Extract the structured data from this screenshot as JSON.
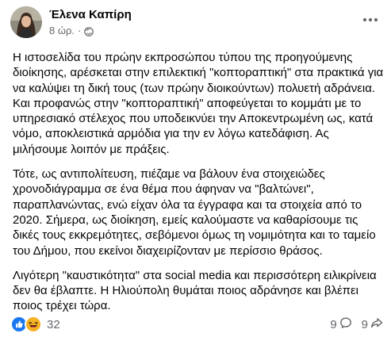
{
  "post": {
    "author": "Έλενα Καπίρη",
    "time": "8 ώρ.",
    "separator": "·",
    "visibility_icon": "globe-icon",
    "more_icon": "more-horizontal-icon",
    "paragraphs": [
      "Η ιστοσελίδα του πρώην εκπροσώπου τύπου της προηγούμενης διοίκησης, αρέσκεται στην επιλεκτική \"κοπτοραπτική\" στα πρακτικά για να καλύψει τη δική τους (των πρώην διοικούντων) πολυετή αδράνεια. Και προφανώς στην \"κοπτοραπτική\" αποφεύγεται το κομμάτι με το υπηρεσιακό στέλεχος που υποδεικνύει την Αποκεντρωμένη ως, κατά νόμο, αποκλειστικά αρμόδια για την εν λόγω κατεδάφιση. Ας  μιλήσουμε λοιπόν με πράξεις.",
      "Τότε, ως αντιπολίτευση,  πιέζαμε να βάλουν ένα στοιχειώδες χρονοδιάγραμμα σε ένα θέμα που άφηναν να \"βαλτώνει\", παραπλανώντας, ενώ είχαν όλα τα έγγραφα και τα στοιχεία από το 2020. Σήμερα, ως διοίκηση, εμείς καλούμαστε να καθαρίσουμε τις δικές τους εκκρεμότητες, σεβόμενοι όμως τη νομιμότητα και το ταμείο του Δήμου, που εκείνοι διαχειρίζονταν με περίσσιο θράσος.",
      "Λιγότερη \"καυστικότητα\" στα social media και περισσότερη ειλικρίνεια δεν θα  έβλαπτε. Η Ηλιούπολη θυμάται ποιος αδράνησε και βλέπει ποιος τρέχει τώρα."
    ]
  },
  "footer": {
    "reactions": [
      "like-reaction-icon",
      "haha-reaction-icon"
    ],
    "reaction_count": "32",
    "comments_count": "9",
    "comments_icon": "comment-icon",
    "shares_count": "9",
    "shares_icon": "share-icon"
  },
  "colors": {
    "like": "#1877f2",
    "haha": "#f7b125",
    "secondary_text": "#65676b"
  }
}
